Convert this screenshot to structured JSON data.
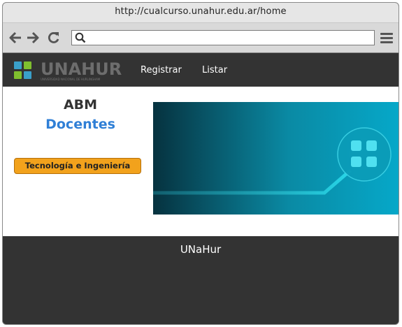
{
  "browser": {
    "title_url": "http://cualcurso.unahur.edu.ar/home",
    "back_icon": "arrow-left-icon",
    "forward_icon": "arrow-right-icon",
    "reload_icon": "reload-icon",
    "search_icon": "search-icon",
    "address_value": "",
    "menu_icon": "hamburger-menu-icon"
  },
  "navbar": {
    "logo_text": "UNAHUR",
    "logo_subtext": "UNIVERSIDAD NACIONAL DE HURLINGHAM",
    "links": [
      "Registrar",
      "Listar"
    ]
  },
  "main": {
    "heading": "ABM",
    "subheading": "Docentes",
    "badge": "Tecnología e Ingeniería"
  },
  "footer": {
    "text": "UNaHur"
  },
  "colors": {
    "navbar_bg": "#333333",
    "accent_blue": "#2f7fd6",
    "badge_orange": "#f2a21c",
    "banner_teal": "#00b4d8"
  }
}
